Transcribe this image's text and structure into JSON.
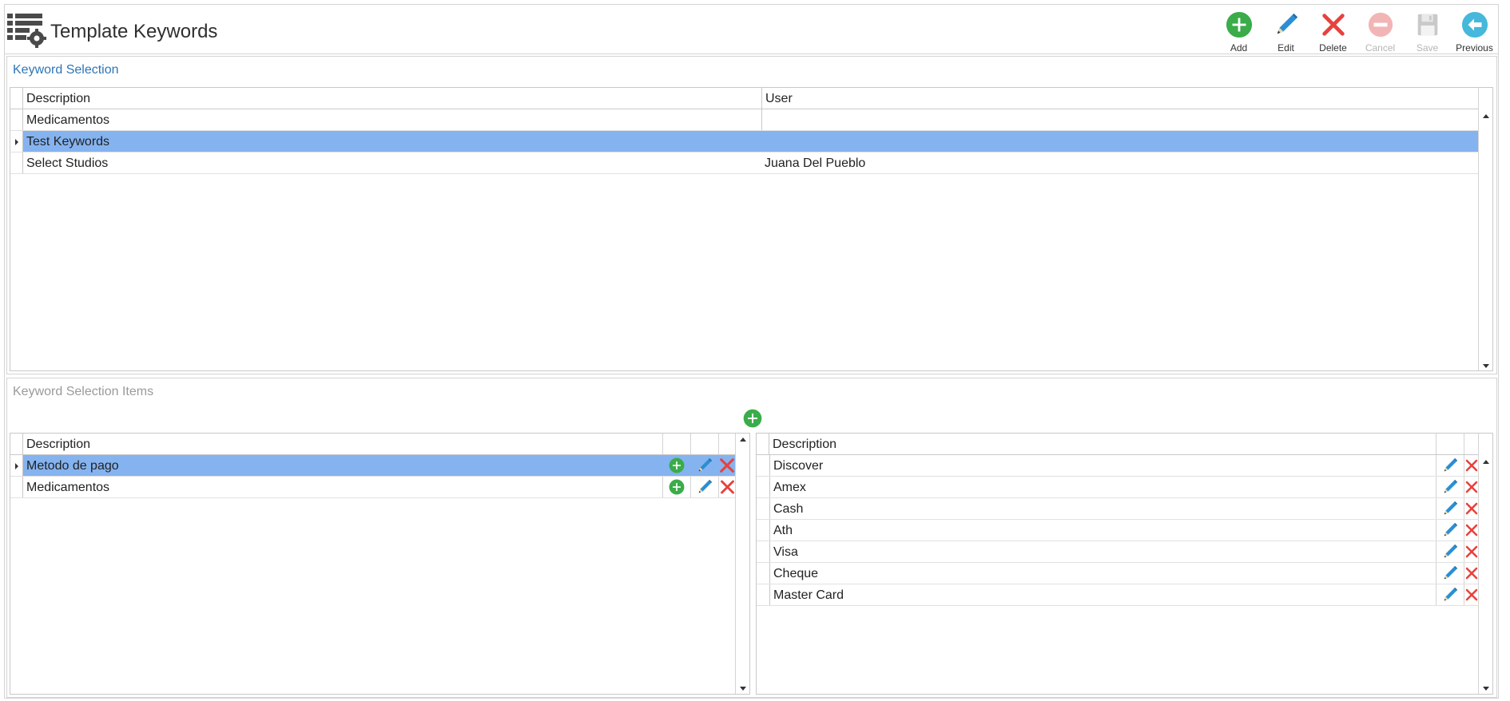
{
  "header": {
    "title": "Template Keywords",
    "app_icon": "list-settings-icon"
  },
  "toolbar": {
    "add_label": "Add",
    "edit_label": "Edit",
    "delete_label": "Delete",
    "cancel_label": "Cancel",
    "save_label": "Save",
    "previous_label": "Previous"
  },
  "keyword_selection": {
    "title": "Keyword Selection",
    "columns": [
      "Description",
      "User"
    ],
    "rows": [
      {
        "description": "Medicamentos",
        "user": ""
      },
      {
        "description": "Test Keywords",
        "user": ""
      },
      {
        "description": "Select Studios",
        "user": "Juana Del Pueblo"
      }
    ],
    "selected_index": 1
  },
  "keyword_items": {
    "title": "Keyword Selection Items",
    "left_grid": {
      "columns": [
        "Description"
      ],
      "rows": [
        {
          "description": "Metodo de pago"
        },
        {
          "description": "Medicamentos"
        }
      ],
      "selected_index": 0
    },
    "right_grid": {
      "columns": [
        "Description"
      ],
      "rows": [
        {
          "description": "Discover"
        },
        {
          "description": "Amex"
        },
        {
          "description": "Cash"
        },
        {
          "description": "Ath"
        },
        {
          "description": "Visa"
        },
        {
          "description": "Cheque"
        },
        {
          "description": "Master Card"
        }
      ]
    }
  },
  "colors": {
    "accent": "#2e75b6",
    "selection": "#85b3ef",
    "add_green": "#3aac49",
    "delete_red": "#e8413c",
    "edit_blue": "#2a8fd3",
    "disabled": "#c8c8c8"
  }
}
